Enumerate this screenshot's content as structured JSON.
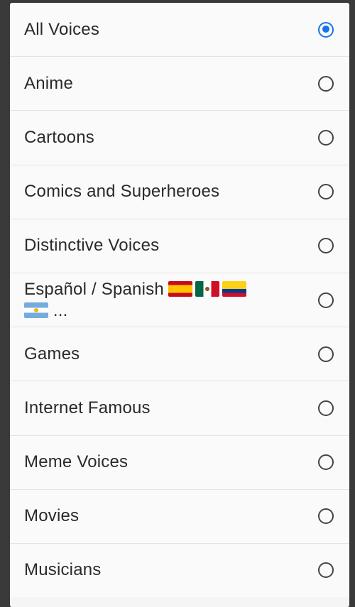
{
  "dialog": {
    "options": [
      {
        "label": "All Voices",
        "selected": true
      },
      {
        "label": "Anime",
        "selected": false
      },
      {
        "label": "Cartoons",
        "selected": false
      },
      {
        "label": "Comics and Superheroes",
        "selected": false
      },
      {
        "label": "Distinctive Voices",
        "selected": false
      },
      {
        "label": "Español / Spanish",
        "suffix": "...",
        "flags": [
          "spain-flag",
          "mexico-flag",
          "colombia-flag",
          "argentina-flag"
        ],
        "selected": false
      },
      {
        "label": "Games",
        "selected": false
      },
      {
        "label": "Internet Famous",
        "selected": false
      },
      {
        "label": "Meme Voices",
        "selected": false
      },
      {
        "label": "Movies",
        "selected": false
      },
      {
        "label": "Musicians",
        "selected": false
      }
    ]
  },
  "colors": {
    "accent": "#1a73e8",
    "background": "#fafafa",
    "divider": "#e4e4e4",
    "text": "#2a2a2a"
  }
}
